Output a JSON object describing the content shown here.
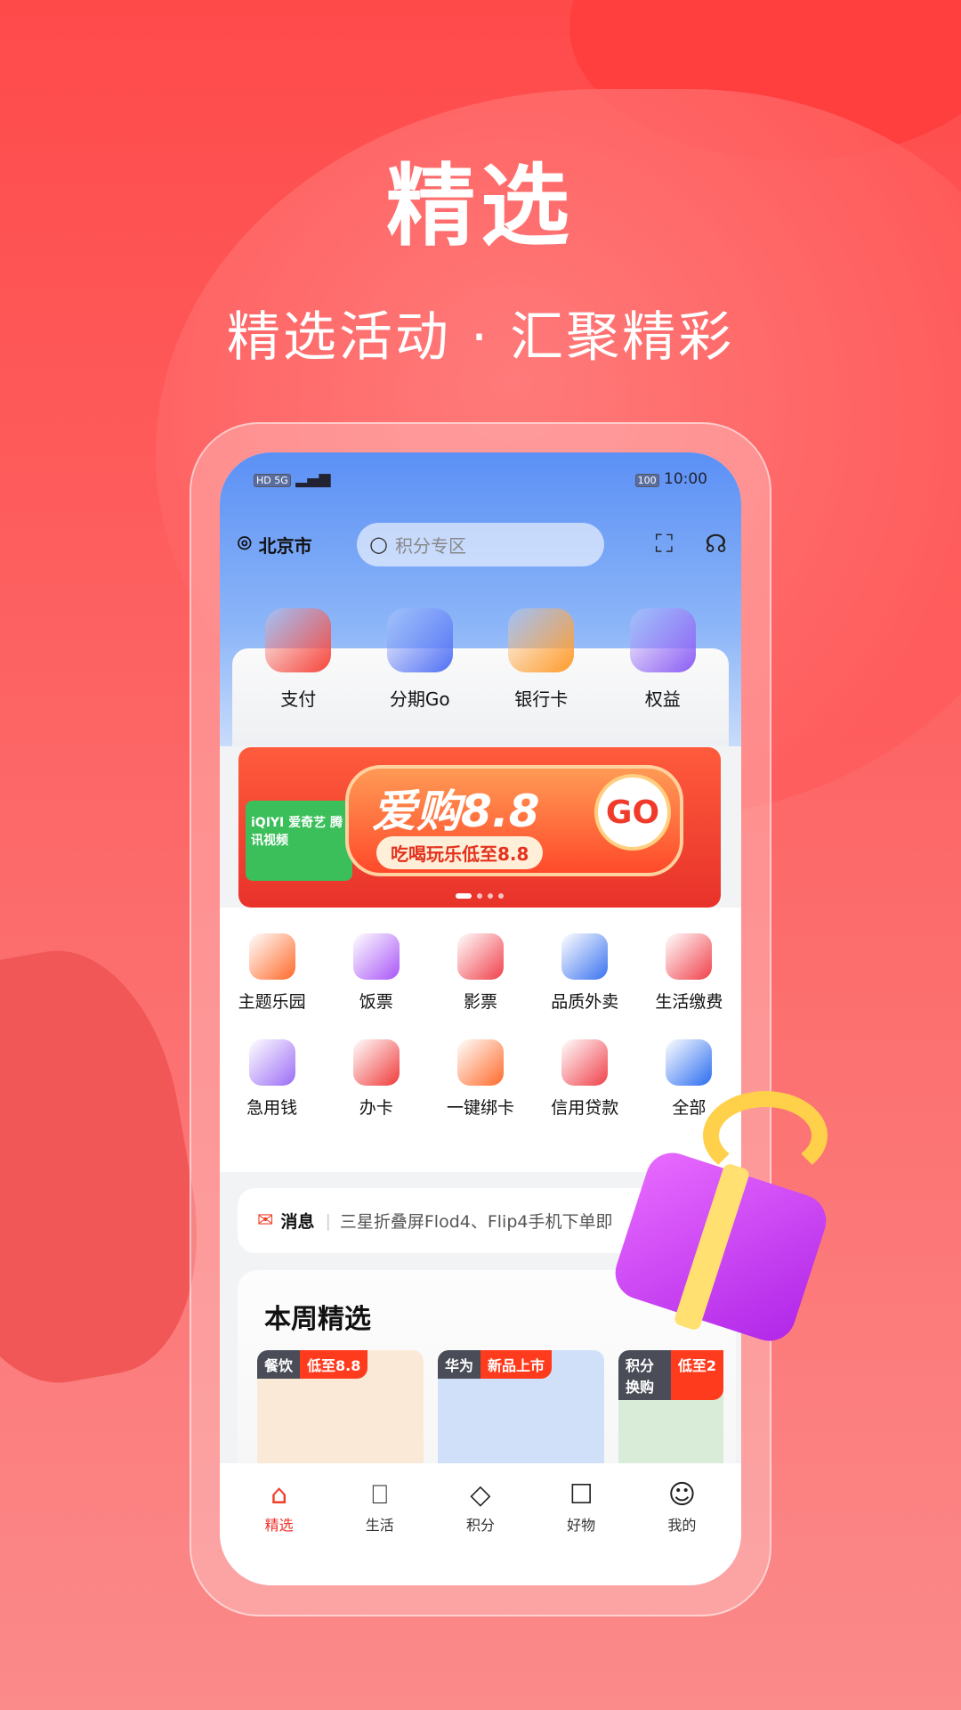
{
  "promo": {
    "headline": "精选",
    "subtitle": "精选活动 · 汇聚精彩"
  },
  "status_bar": {
    "left": "HD 5G",
    "battery": "100",
    "time": "10:00"
  },
  "header": {
    "location": "北京市",
    "search_placeholder": "积分专区",
    "icons": [
      "scan-icon",
      "customer-service-icon"
    ]
  },
  "quick_entries": [
    {
      "label": "支付",
      "color": "#f5443a"
    },
    {
      "label": "分期Go",
      "color": "#4f6ff5"
    },
    {
      "label": "银行卡",
      "color": "#ff9a2a"
    },
    {
      "label": "权益",
      "color": "#8a5cf5"
    }
  ],
  "banner": {
    "title": "爱购8.8",
    "go": "GO",
    "tagline": "吃喝玩乐低至8.8",
    "logos": "iQIYI 爱奇艺 腾讯视频",
    "active_dot": 0,
    "dot_count": 4
  },
  "services": [
    {
      "label": "主题乐园",
      "color": "#ff6a2a"
    },
    {
      "label": "饭票",
      "color": "#a855f7"
    },
    {
      "label": "影票",
      "color": "#f0404a"
    },
    {
      "label": "品质外卖",
      "color": "#3a72f0"
    },
    {
      "label": "生活缴费",
      "color": "#f0404a"
    },
    {
      "label": "急用钱",
      "color": "#9b6cf5"
    },
    {
      "label": "办卡",
      "color": "#f03a3a"
    },
    {
      "label": "一键绑卡",
      "color": "#ff6a2a"
    },
    {
      "label": "信用贷款",
      "color": "#f0404a"
    },
    {
      "label": "全部",
      "color": "#2a6cf0"
    }
  ],
  "message": {
    "label": "消息",
    "text": "三星折叠屏Flod4、Flip4手机下单即"
  },
  "weekly": {
    "title": "本周精选",
    "cards": [
      {
        "tag1": "餐饮",
        "tag2": "低至8.8",
        "bg": "#fbe9d8"
      },
      {
        "tag1": "华为",
        "tag2": "新品上市",
        "bg": "#cfe0f8"
      },
      {
        "tag1": "积分换购",
        "tag2": "低至2",
        "bg": "#d8ecd8"
      }
    ]
  },
  "nav": [
    {
      "label": "精选",
      "active": true
    },
    {
      "label": "生活"
    },
    {
      "label": "积分"
    },
    {
      "label": "好物"
    },
    {
      "label": "我的"
    }
  ],
  "colors": {
    "accent": "#f0302a",
    "background": "#fb6a6a"
  }
}
